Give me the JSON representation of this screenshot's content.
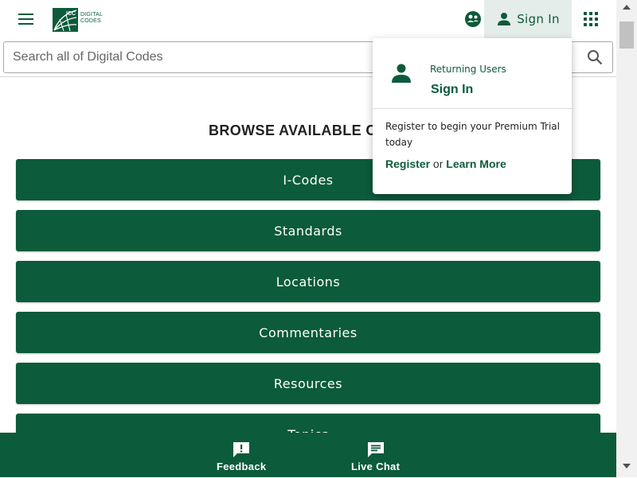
{
  "header": {
    "logo_line1": "DIGITAL",
    "logo_line2": "CODES",
    "logo_mark_text": "ICC",
    "signin_label": "Sign In",
    "icons": {
      "menu": "hamburger-menu-icon",
      "community": "community-icon",
      "user": "person-icon",
      "apps": "apps-grid-icon"
    }
  },
  "search": {
    "placeholder": "Search all of Digital Codes",
    "value": "",
    "icon": "search-icon"
  },
  "main": {
    "title": "BROWSE AVAILABLE CONT",
    "categories": [
      {
        "label": "I-Codes"
      },
      {
        "label": "Standards"
      },
      {
        "label": "Locations"
      },
      {
        "label": "Commentaries"
      },
      {
        "label": "Resources"
      },
      {
        "label": "Topics"
      }
    ]
  },
  "dropdown": {
    "returning_label": "Returning Users",
    "signin_link": "Sign In",
    "register_text": "Register to begin your Premium Trial today",
    "register_link": "Register",
    "or_text": "or",
    "learn_more_link": "Learn More"
  },
  "bottom_bar": {
    "feedback_label": "Feedback",
    "livechat_label": "Live Chat"
  },
  "colors": {
    "brand_green": "#0c5b3b",
    "signin_bg": "#e4ede9"
  }
}
